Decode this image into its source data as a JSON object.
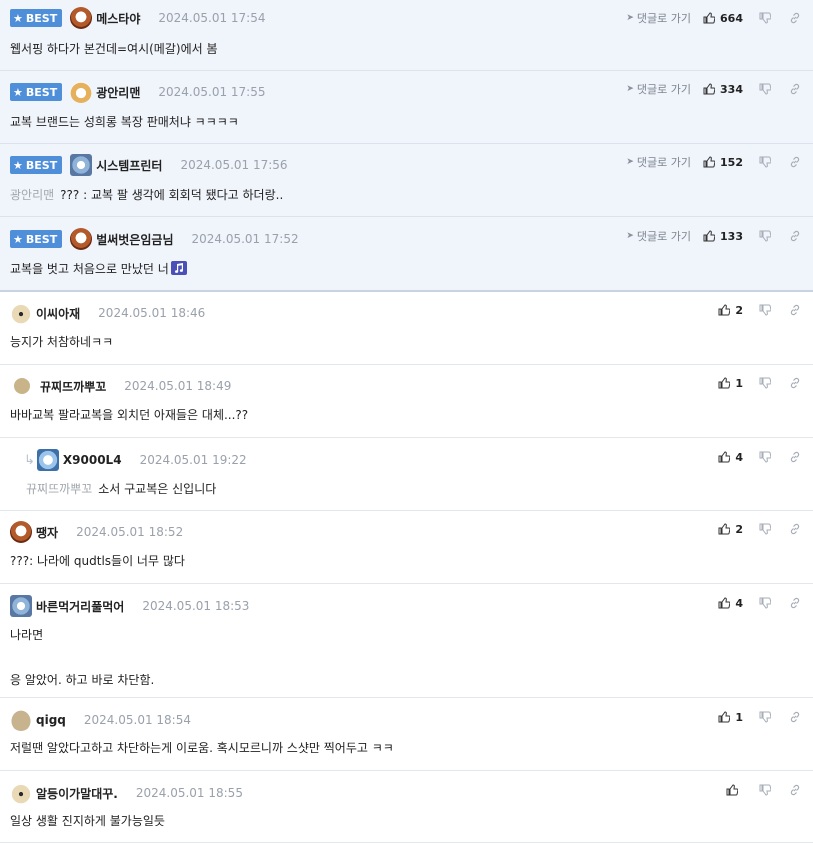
{
  "best_label": "BEST",
  "goto_label": "댓글로 가기",
  "colors": {
    "best_bg": "#f0f4fb",
    "badge_bg": "#4f8ed8",
    "separator": "#e3e6ec"
  },
  "icons": [
    "star-icon",
    "paper-plane-icon",
    "thumbs-up-icon",
    "thumbs-down-icon",
    "link-icon",
    "reply-arrow-icon",
    "music-note-icon"
  ],
  "best_comments": [
    {
      "nick": "메스타야",
      "date": "2024.05.01 17:54",
      "likes": "664",
      "text": "웹서핑 하다가 본건데=여시(메갈)에서 봄"
    },
    {
      "nick": "광안리맨",
      "date": "2024.05.01 17:55",
      "likes": "334",
      "text": "교복 브랜드는 성희롱 복장 판매처냐 ㅋㅋㅋㅋ"
    },
    {
      "nick": "시스템프린터",
      "date": "2024.05.01 17:56",
      "likes": "152",
      "mention": "광안리맨",
      "text": "??? : 교복 팔 생각에 회회덕 됐다고 하더랑.."
    },
    {
      "nick": "벌써벗은임금님",
      "date": "2024.05.01 17:52",
      "likes": "133",
      "text": "교복을 벗고 처음으로 만났던 너"
    }
  ],
  "comments": [
    {
      "nick": "이씨아재",
      "date": "2024.05.01 18:46",
      "likes": "2",
      "text": "능지가 처참하네ㅋㅋ"
    },
    {
      "nick": "뀨찌뜨까뿌꼬",
      "date": "2024.05.01 18:49",
      "likes": "1",
      "text": "바바교복 팔라교복을 외치던 아재들은 대체...??"
    },
    {
      "nick": "X9000L4",
      "date": "2024.05.01 19:22",
      "likes": "4",
      "mention": "뀨찌뜨까뿌꼬",
      "text": "소서 구교복은 신입니다"
    },
    {
      "nick": "땡자",
      "date": "2024.05.01 18:52",
      "likes": "2",
      "text": "???: 나라에 qudtls들이 너무 많다"
    },
    {
      "nick": "바른먹거리풀먹어",
      "date": "2024.05.01 18:53",
      "likes": "4",
      "text": "나라면",
      "text2": "응 알았어. 하고 바로 차단함."
    },
    {
      "nick": "qigq",
      "date": "2024.05.01 18:54",
      "likes": "1",
      "text": "저럴땐 알았다고하고 차단하는게 이로움. 혹시모르니까 스샷만 찍어두고 ㅋㅋ"
    },
    {
      "nick": "알등이가말대꾸.",
      "date": "2024.05.01 18:55",
      "likes": "",
      "text": "일상 생활 진지하게 불가능일듯"
    }
  ]
}
